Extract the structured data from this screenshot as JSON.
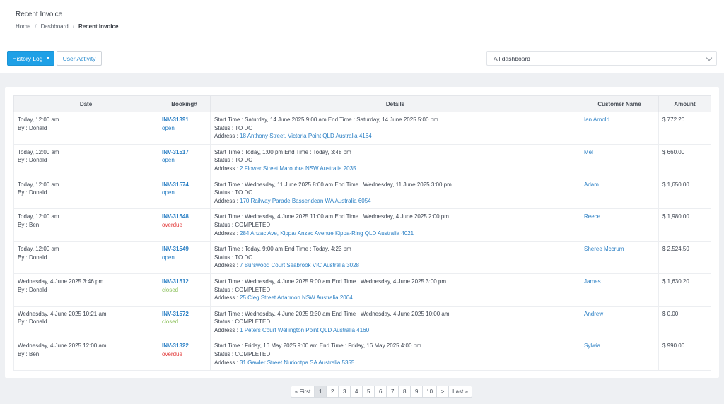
{
  "header": {
    "title": "Recent Invoice",
    "breadcrumb": [
      "Home",
      "Dashboard",
      "Recent Invoice"
    ]
  },
  "toolbar": {
    "history_label": "History Log",
    "activity_label": "User Activity",
    "dashboard_select": "All dashboard"
  },
  "table": {
    "columns": [
      "Date",
      "Booking#",
      "Details",
      "Customer Name",
      "Amount"
    ],
    "rows": [
      {
        "date": "Today, 12:00 am",
        "by": "By : Donald",
        "booking": "INV-31391",
        "status": "open",
        "start": "Start Time : Saturday, 14 June 2025 9:00 am End Time : Saturday, 14 June 2025 5:00 pm",
        "state": "Status : TO DO",
        "addr_label": "Address : ",
        "addr": "18 Anthony Street, Victoria Point QLD Australia 4164",
        "customer": "Ian Arnold",
        "amount": "$ 772.20"
      },
      {
        "date": "Today, 12:00 am",
        "by": "By : Donald",
        "booking": "INV-31517",
        "status": "open",
        "start": "Start Time : Today, 1:00 pm End Time : Today, 3:48 pm",
        "state": "Status : TO DO",
        "addr_label": "Address : ",
        "addr": "2 Flower Street Maroubra NSW Australia 2035",
        "customer": "Mel",
        "amount": "$ 660.00"
      },
      {
        "date": "Today, 12:00 am",
        "by": "By : Donald",
        "booking": "INV-31574",
        "status": "open",
        "start": "Start Time : Wednesday, 11 June 2025 8:00 am End Time : Wednesday, 11 June 2025 3:00 pm",
        "state": "Status : TO DO",
        "addr_label": "Address : ",
        "addr": "170 Railway Parade Bassendean WA Australia 6054",
        "customer": "Adam",
        "amount": "$ 1,650.00"
      },
      {
        "date": "Today, 12:00 am",
        "by": "By : Ben",
        "booking": "INV-31548",
        "status": "overdue",
        "start": "Start Time : Wednesday, 4 June 2025 11:00 am End Time : Wednesday, 4 June 2025 2:00 pm",
        "state": "Status : COMPLETED",
        "addr_label": "Address : ",
        "addr": "284 Anzac Ave, Kippa/ Anzac Avenue Kippa-Ring QLD Australia 4021",
        "customer": "Reece .",
        "amount": "$ 1,980.00"
      },
      {
        "date": "Today, 12:00 am",
        "by": "By : Donald",
        "booking": "INV-31549",
        "status": "open",
        "start": "Start Time : Today, 9:00 am End Time : Today, 4:23 pm",
        "state": "Status : TO DO",
        "addr_label": "Address : ",
        "addr": "7 Burswood Court Seabrook VIC Australia 3028",
        "customer": "Sheree Mccrum",
        "amount": "$ 2,524.50"
      },
      {
        "date": "Wednesday, 4 June 2025 3:46 pm",
        "by": "By : Donald",
        "booking": "INV-31512",
        "status": "closed",
        "start": "Start Time : Wednesday, 4 June 2025 9:00 am End Time : Wednesday, 4 June 2025 3:00 pm",
        "state": "Status : COMPLETED",
        "addr_label": "Address : ",
        "addr": "25 Cleg Street Artarmon NSW Australia 2064",
        "customer": "James",
        "amount": "$ 1,630.20"
      },
      {
        "date": "Wednesday, 4 June 2025 10:21 am",
        "by": "By : Donald",
        "booking": "INV-31572",
        "status": "closed",
        "start": "Start Time : Wednesday, 4 June 2025 9:30 am End Time : Wednesday, 4 June 2025 10:00 am",
        "state": "Status : COMPLETED",
        "addr_label": "Address : ",
        "addr": "1 Peters Court Wellington Point QLD Australia 4160",
        "customer": "Andrew",
        "amount": "$ 0.00"
      },
      {
        "date": "Wednesday, 4 June 2025 12:00 am",
        "by": "By : Ben",
        "booking": "INV-31322",
        "status": "overdue",
        "start": "Start Time : Friday, 16 May 2025 9:00 am End Time : Friday, 16 May 2025 4:00 pm",
        "state": "Status : COMPLETED",
        "addr_label": "Address : ",
        "addr": "31 Gawler Street Nuriootpa SA Australia 5355",
        "customer": "Sylwia",
        "amount": "$ 990.00"
      }
    ]
  },
  "pagination": {
    "items": [
      "« First",
      "1",
      "2",
      "3",
      "4",
      "5",
      "6",
      "7",
      "8",
      "9",
      "10",
      ">",
      "Last »"
    ],
    "active": "1"
  },
  "colors": {
    "accent": "#1ea0e6",
    "link": "#2a7fc4",
    "overdue": "#e23a3a",
    "closed": "#8cc15b"
  }
}
